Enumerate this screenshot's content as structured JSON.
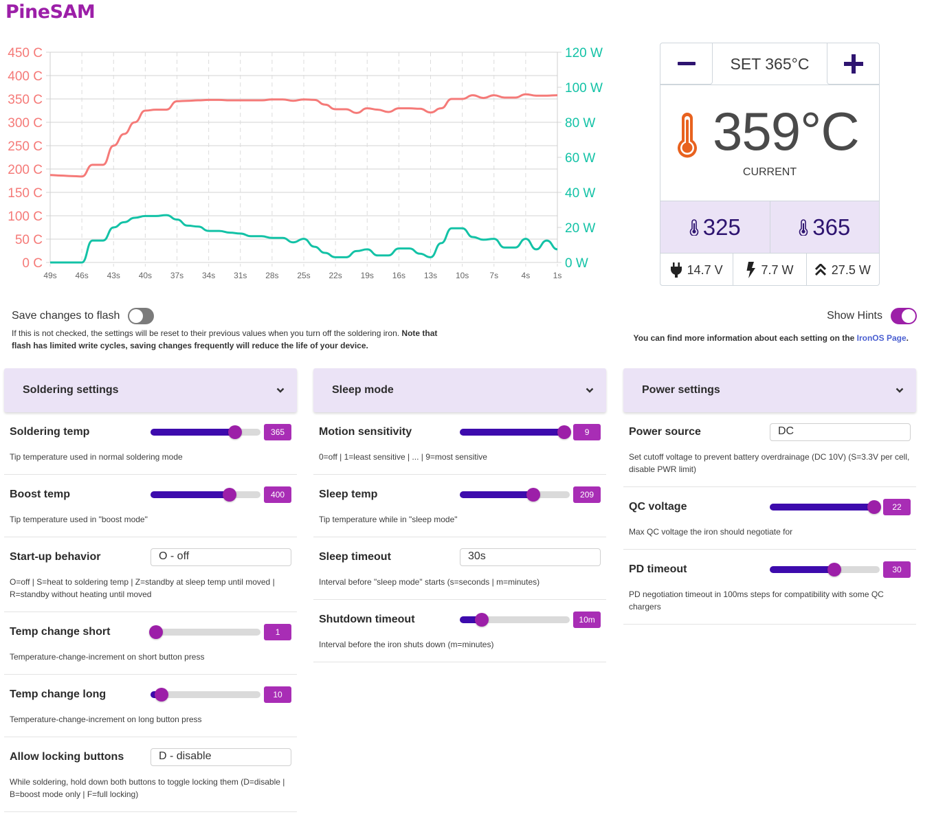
{
  "app": {
    "title": "PineSAM"
  },
  "chart_data": {
    "type": "line",
    "title": "",
    "x": [
      49,
      48,
      47,
      46,
      45,
      44,
      43,
      42,
      41,
      40,
      39,
      38,
      37,
      36,
      35,
      34,
      33,
      32,
      31,
      30,
      29,
      28,
      27,
      26,
      25,
      24,
      23,
      22,
      21,
      20,
      19,
      18,
      17,
      16,
      15,
      14,
      13,
      12,
      11,
      10,
      9,
      8,
      7,
      6,
      5,
      4,
      3,
      2,
      1
    ],
    "x_tick_labels": [
      "49s",
      "46s",
      "43s",
      "40s",
      "37s",
      "34s",
      "31s",
      "28s",
      "25s",
      "22s",
      "19s",
      "16s",
      "13s",
      "10s",
      "7s",
      "4s",
      "1s"
    ],
    "y_left": {
      "label": "",
      "ticks": [
        "0 C",
        "50 C",
        "100 C",
        "150 C",
        "200 C",
        "250 C",
        "300 C",
        "350 C",
        "400 C",
        "450 C"
      ],
      "range": [
        0,
        450
      ],
      "color": "#f57a78"
    },
    "y_right": {
      "label": "",
      "ticks": [
        "0 W",
        "20 W",
        "40 W",
        "60 W",
        "80 W",
        "100 W",
        "120 W"
      ],
      "range": [
        0,
        120
      ],
      "color": "#13c2a6"
    },
    "grid": true,
    "series": [
      {
        "name": "Temperature",
        "axis": "left",
        "color": "#f57a78",
        "values": [
          187,
          186,
          185,
          184,
          209,
          209,
          250,
          275,
          300,
          325,
          327,
          327,
          345,
          346,
          347,
          348,
          348,
          347,
          347,
          347,
          347,
          349,
          349,
          346,
          349,
          348,
          338,
          328,
          328,
          320,
          330,
          327,
          322,
          330,
          330,
          329,
          321,
          330,
          350,
          350,
          358,
          352,
          358,
          353,
          353,
          360,
          357,
          357,
          358
        ]
      },
      {
        "name": "Power",
        "axis": "right",
        "color": "#13c2a6",
        "values": [
          0,
          0,
          0,
          0,
          12.5,
          12.5,
          20,
          23,
          25.5,
          26.5,
          26.5,
          27,
          24.5,
          21,
          20.5,
          18,
          18,
          17,
          16.5,
          15,
          15,
          14,
          14,
          11.5,
          13.5,
          9,
          5.5,
          3,
          3,
          6.5,
          7.5,
          4,
          4,
          8,
          8,
          5,
          3,
          11,
          19.5,
          19.5,
          14.5,
          13,
          13.5,
          8.5,
          8.5,
          13.5,
          7.5,
          12.5,
          7.5
        ]
      }
    ]
  },
  "control": {
    "set_label": "SET 365°C",
    "current_temp": "359°C",
    "current_label": "CURRENT",
    "presets": [
      "325",
      "365"
    ],
    "stats": {
      "voltage": "14.7 V",
      "power": "7.7 W",
      "max_power": "27.5 W"
    }
  },
  "flash": {
    "label": "Save changes to flash",
    "enabled": false,
    "help_plain": "If this is not checked, the settings will be reset to their previous values when you turn off the soldering iron. ",
    "help_bold": "Note that flash has limited write cycles, saving changes frequently will reduce the life of your device."
  },
  "hints": {
    "label": "Show Hints",
    "enabled": true,
    "help_prefix": "You can find more information about each setting on the ",
    "help_link": "IronOS Page",
    "help_suffix": "."
  },
  "panels": [
    {
      "title": "Soldering settings",
      "settings": [
        {
          "name": "Soldering temp",
          "type": "slider",
          "value": "365",
          "fraction": 0.77,
          "desc": "Tip temperature used in normal soldering mode"
        },
        {
          "name": "Boost temp",
          "type": "slider",
          "value": "400",
          "fraction": 0.72,
          "desc": "Tip temperature used in \"boost mode\""
        },
        {
          "name": "Start-up behavior",
          "type": "select",
          "value": "O - off",
          "desc": "O=off | S=heat to soldering temp | Z=standby at sleep temp until moved | R=standby without heating until moved"
        },
        {
          "name": "Temp change short",
          "type": "slider",
          "value": "1",
          "fraction": 0.05,
          "desc": "Temperature-change-increment on short button press"
        },
        {
          "name": "Temp change long",
          "type": "slider",
          "value": "10",
          "fraction": 0.1,
          "desc": "Temperature-change-increment on long button press"
        },
        {
          "name": "Allow locking buttons",
          "type": "select",
          "value": "D - disable",
          "desc": "While soldering, hold down both buttons to toggle locking them (D=disable | B=boost mode only | F=full locking)"
        }
      ]
    },
    {
      "title": "Sleep mode",
      "settings": [
        {
          "name": "Motion sensitivity",
          "type": "slider",
          "value": "9",
          "fraction": 0.95,
          "desc": "0=off | 1=least sensitive | ... | 9=most sensitive"
        },
        {
          "name": "Sleep temp",
          "type": "slider",
          "value": "209",
          "fraction": 0.67,
          "desc": "Tip temperature while in \"sleep mode\""
        },
        {
          "name": "Sleep timeout",
          "type": "select",
          "value": "30s",
          "desc": "Interval before \"sleep mode\" starts (s=seconds | m=minutes)"
        },
        {
          "name": "Shutdown timeout",
          "type": "slider",
          "value": "10m",
          "fraction": 0.2,
          "desc": "Interval before the iron shuts down (m=minutes)"
        }
      ]
    },
    {
      "title": "Power settings",
      "settings": [
        {
          "name": "Power source",
          "type": "select",
          "value": "DC",
          "desc": "Set cutoff voltage to prevent battery overdrainage (DC 10V) (S=3.3V per cell, disable PWR limit)"
        },
        {
          "name": "QC voltage",
          "type": "slider",
          "value": "22",
          "fraction": 0.95,
          "desc": "Max QC voltage the iron should negotiate for"
        },
        {
          "name": "PD timeout",
          "type": "slider",
          "value": "30",
          "fraction": 0.59,
          "desc": "PD negotiation timeout in 100ms steps for compatibility with some QC chargers"
        }
      ]
    }
  ]
}
